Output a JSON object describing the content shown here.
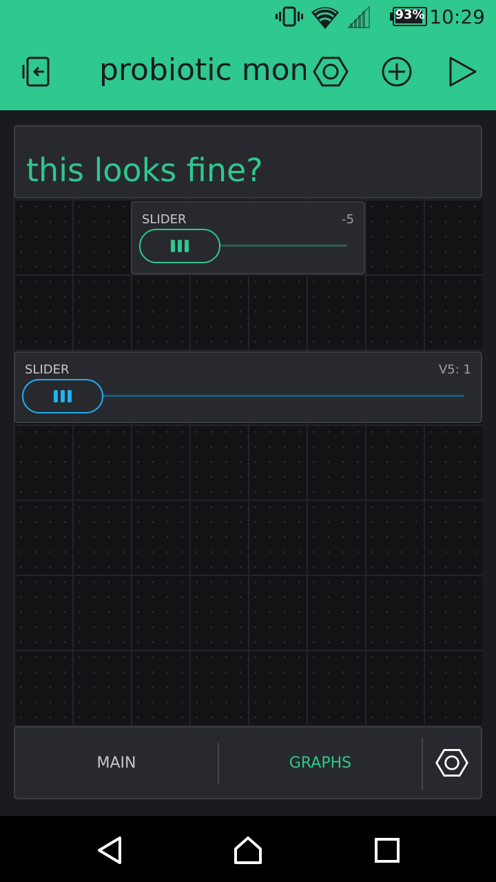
{
  "status": {
    "time": "10:29",
    "battery_percent": "93%",
    "battery_level": 0.93,
    "icons": [
      "vibrate-icon",
      "wifi-icon",
      "cell-signal-icon",
      "battery-icon"
    ]
  },
  "toolbar": {
    "title": "probiotic monit",
    "icons": [
      "exit-icon",
      "hexagon-settings-icon",
      "add-circle-icon",
      "play-icon"
    ]
  },
  "label_widget": {
    "text": "this looks fine?"
  },
  "slider1": {
    "title": "SLIDER",
    "value": "-5",
    "accent": "#2fc88f"
  },
  "slider2": {
    "title": "SLIDER",
    "value": "V5: 1",
    "accent": "#1fb2f0"
  },
  "tabs": {
    "main": "MAIN",
    "graphs": "GRAPHS",
    "active": "GRAPHS",
    "settings_icon": "hexagon-settings-icon"
  },
  "navbar": {
    "icons": [
      "back-icon",
      "home-icon",
      "recents-icon"
    ]
  },
  "colors": {
    "brand": "#2fc88f",
    "background": "#1a1b1f",
    "widget": "#28292e",
    "blue_accent": "#1fb2f0"
  }
}
